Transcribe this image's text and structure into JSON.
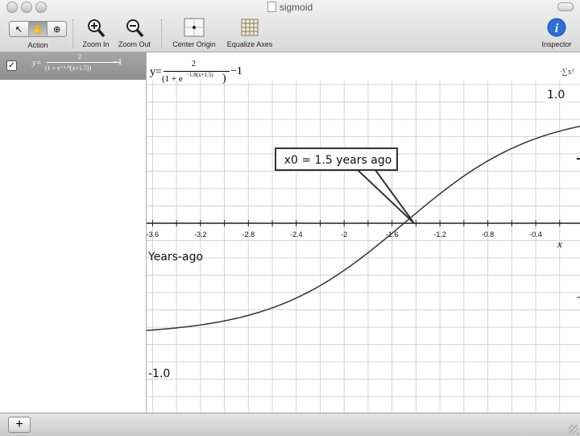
{
  "window": {
    "title": "sigmoid"
  },
  "toolbar": {
    "action_label": "Action",
    "zoom_in_label": "Zoom In",
    "zoom_out_label": "Zoom Out",
    "center_origin_label": "Center Origin",
    "equalize_axes_label": "Equalize Axes",
    "inspector_label": "Inspector"
  },
  "equation": {
    "lhs": "y=",
    "numerator": "2",
    "denominator": "(1 + e⁻¹·⁸(x+1.5))",
    "denominator_main": "(1 + e",
    "exponent": "−1.8(x+1.5)",
    "close": ")",
    "tail": "−1"
  },
  "graph": {
    "x_axis_label": "x",
    "callout_text": "x0 = 1.5 years ago",
    "y_axis_title": "Years-ago",
    "y_top_label": "1.0",
    "y_bottom_label": "-1.0",
    "x_ticks": [
      {
        "v": -3.6,
        "label": "-3.6"
      },
      {
        "v": -3.2,
        "label": "-3.2"
      },
      {
        "v": -2.8,
        "label": "-2.8"
      },
      {
        "v": -2.4,
        "label": "-2.4"
      },
      {
        "v": -2.0,
        "label": "-2"
      },
      {
        "v": -1.6,
        "label": "-1.6"
      },
      {
        "v": -1.2,
        "label": "-1.2"
      },
      {
        "v": -0.8,
        "label": "-0.8"
      },
      {
        "v": -0.4,
        "label": "-0.4"
      }
    ],
    "curve": {
      "type": "sigmoid",
      "amplitude": 2,
      "k": 1.8,
      "x0": -1.5,
      "offset": -1
    },
    "x_range": [
      -3.65,
      -0.03
    ],
    "y_range": [
      -1.45,
      1.45
    ]
  }
}
